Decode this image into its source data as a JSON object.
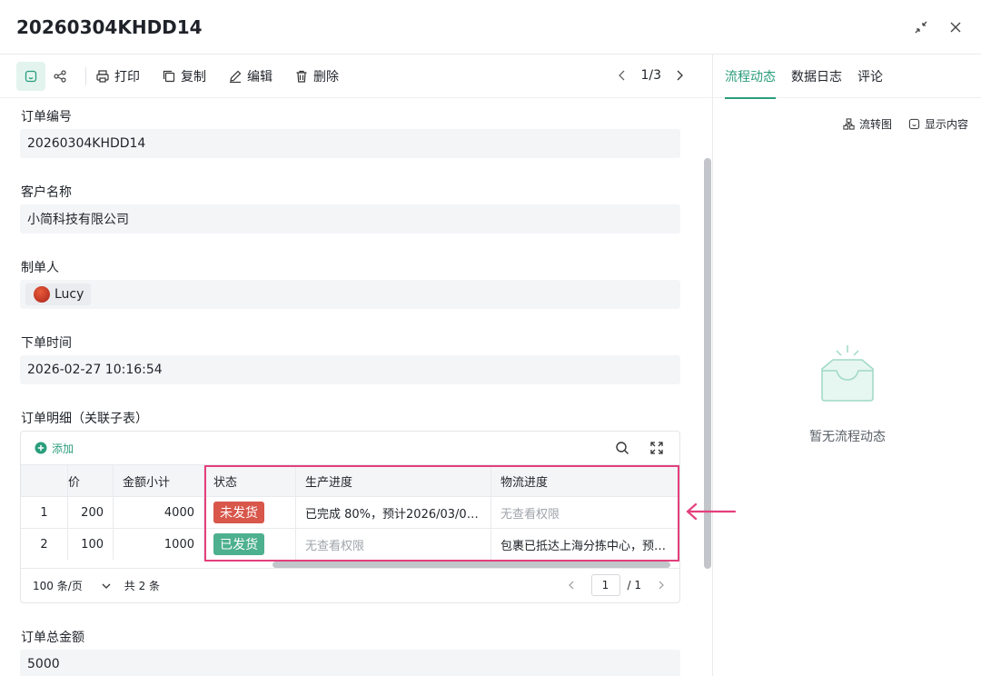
{
  "header": {
    "title": "20260304KHDD14"
  },
  "toolbar": {
    "print_label": "打印",
    "copy_label": "复制",
    "edit_label": "编辑",
    "delete_label": "删除",
    "pager": "1/3"
  },
  "fields": {
    "order_no_label": "订单编号",
    "order_no_value": "20260304KHDD14",
    "customer_label": "客户名称",
    "customer_value": "小简科技有限公司",
    "creator_label": "制单人",
    "creator_value": "Lucy",
    "order_time_label": "下单时间",
    "order_time_value": "2026-02-27 10:16:54",
    "detail_label": "订单明细（关联子表）",
    "total_label": "订单总金额",
    "total_value": "5000"
  },
  "subtable": {
    "add_label": "添加",
    "columns": {
      "price": "价",
      "amount": "金额小计",
      "status": "状态",
      "production": "生产进度",
      "logistics": "物流进度"
    },
    "rows": [
      {
        "idx": "1",
        "price": "200",
        "amount": "4000",
        "status": "未发货",
        "production": "已完成 80%，预计2026/03/02…",
        "logistics": "无查看权限"
      },
      {
        "idx": "2",
        "price": "100",
        "amount": "1000",
        "status": "已发货",
        "production": "无查看权限",
        "logistics": "包裹已抵达上海分拣中心，预计…"
      }
    ],
    "page_size": "100 条/页",
    "total": "共 2 条",
    "page": "1",
    "page_total": "/ 1"
  },
  "side": {
    "tabs": [
      "流程动态",
      "数据日志",
      "评论"
    ],
    "flow_chart_label": "流转图",
    "show_content_label": "显示内容",
    "empty_text": "暂无流程动态"
  },
  "colors": {
    "accent": "#2a9d7c",
    "highlight": "#e43f7c",
    "badge_red": "#d8564a",
    "badge_green": "#4db08f"
  }
}
